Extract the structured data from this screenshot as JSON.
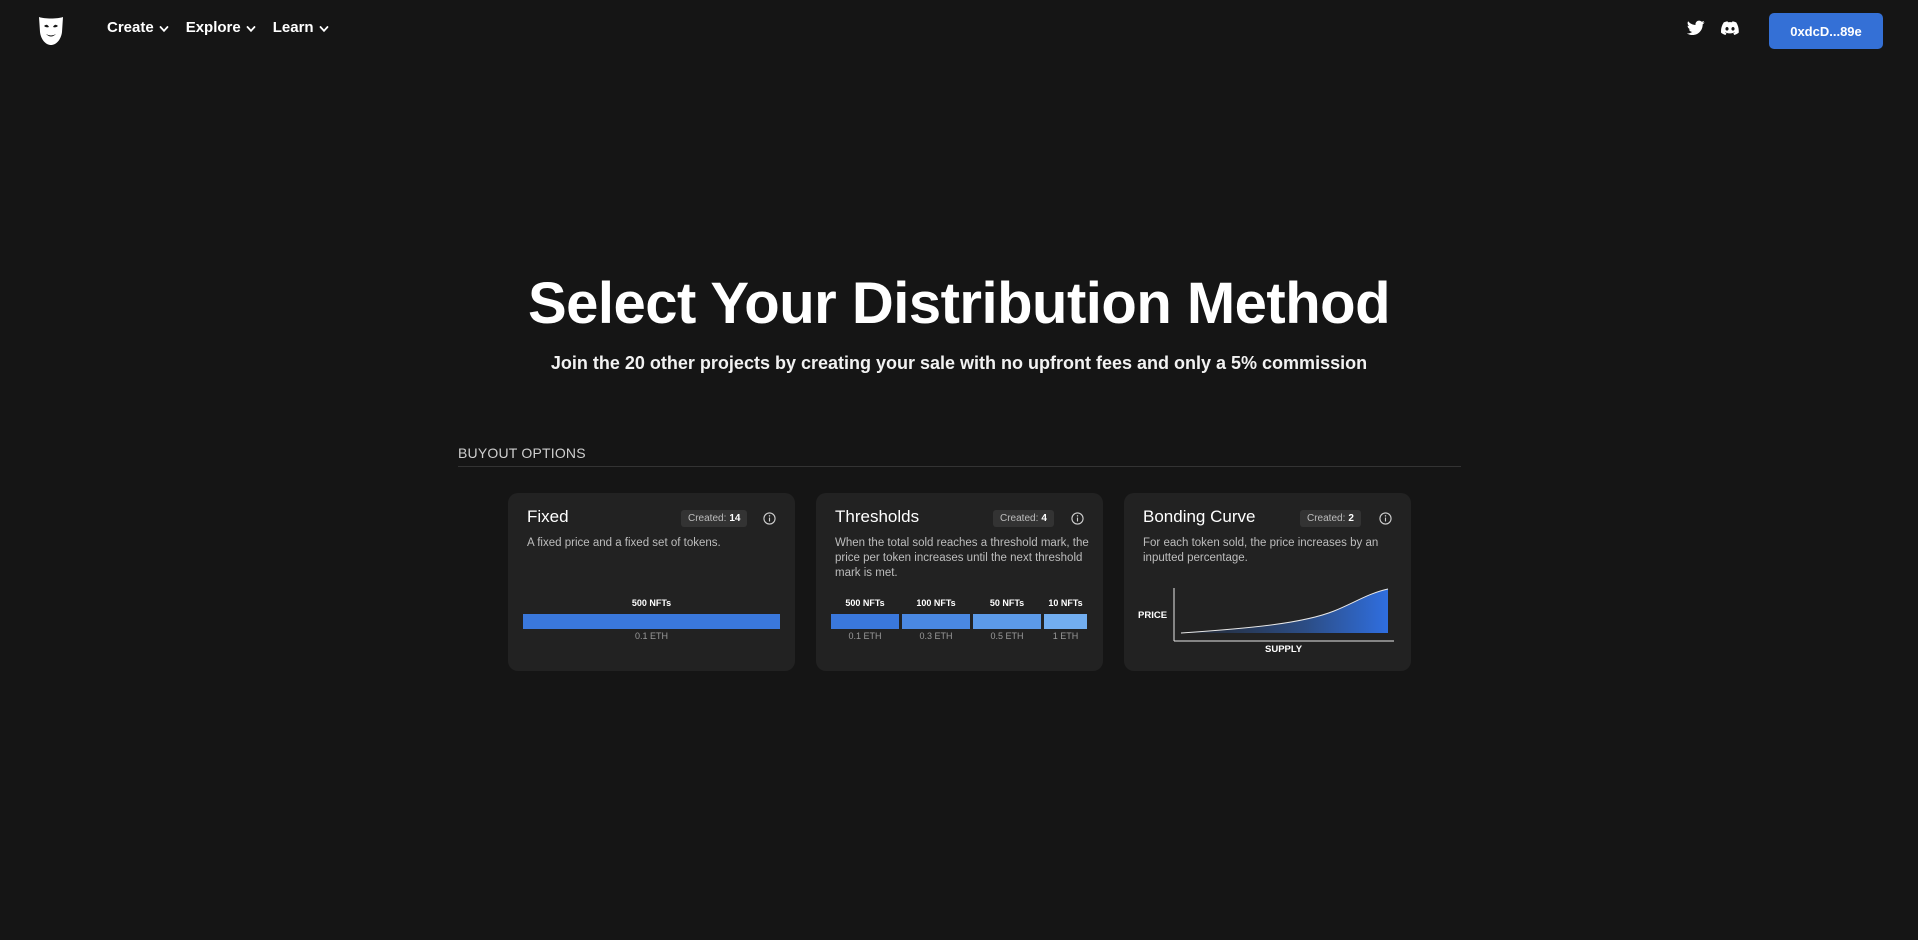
{
  "nav": {
    "menu": [
      {
        "label": "Create"
      },
      {
        "label": "Explore"
      },
      {
        "label": "Learn"
      }
    ],
    "wallet": "0xdcD...89e"
  },
  "hero": {
    "title": "Select Your Distribution Method",
    "subtitle": "Join the 20 other projects by creating your sale with no upfront fees and only a 5% commission"
  },
  "section": {
    "label": "BUYOUT OPTIONS"
  },
  "cards": [
    {
      "title": "Fixed",
      "created_label": "Created:",
      "created_count": "14",
      "description": "A fixed price and a fixed set of tokens.",
      "tiers": [
        {
          "nfts": "500 NFTs",
          "price": "0.1 ETH"
        }
      ]
    },
    {
      "title": "Thresholds",
      "created_label": "Created:",
      "created_count": "4",
      "description": "When the total sold reaches a threshold mark, the price per token increases until the next threshold mark is met.",
      "tiers": [
        {
          "nfts": "500 NFTs",
          "price": "0.1 ETH"
        },
        {
          "nfts": "100 NFTs",
          "price": "0.3 ETH"
        },
        {
          "nfts": "50 NFTs",
          "price": "0.5 ETH"
        },
        {
          "nfts": "10 NFTs",
          "price": "1 ETH"
        }
      ]
    },
    {
      "title": "Bonding Curve",
      "created_label": "Created:",
      "created_count": "2",
      "description": "For each token sold, the price increases by an inputted percentage.",
      "y_axis": "PRICE",
      "x_axis": "SUPPLY"
    }
  ],
  "colors": {
    "accent": "#3470d6",
    "tier_1": "#3a78dc",
    "tier_2": "#4a88e2",
    "tier_3": "#5c9ae8",
    "tier_4": "#72aef0"
  },
  "icons": {
    "logo": "mask-logo-icon",
    "chevron": "chevron-down-icon",
    "twitter": "twitter-icon",
    "discord": "discord-icon",
    "info": "info-icon"
  }
}
